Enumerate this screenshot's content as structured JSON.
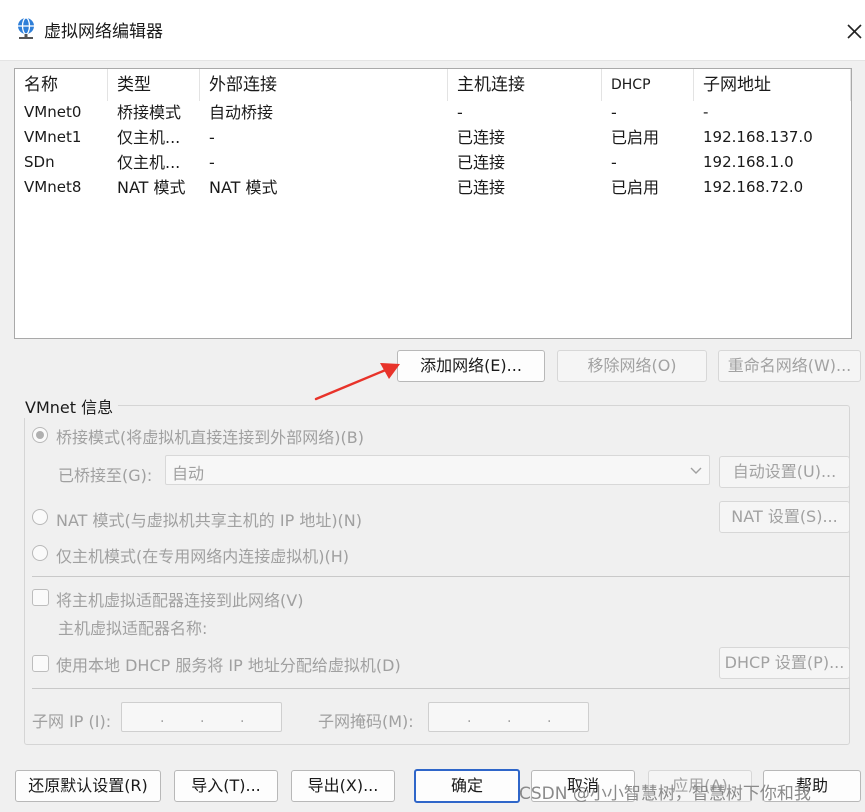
{
  "window": {
    "title": "虚拟网络编辑器"
  },
  "table": {
    "columns": [
      "名称",
      "类型",
      "外部连接",
      "主机连接",
      "DHCP",
      "子网地址"
    ],
    "rows": [
      [
        "VMnet0",
        "桥接模式",
        "自动桥接",
        "-",
        "-",
        "-"
      ],
      [
        "VMnet1",
        "仅主机...",
        "-",
        "已连接",
        "已启用",
        "192.168.137.0"
      ],
      [
        "SDn",
        "仅主机...",
        "-",
        "已连接",
        "-",
        "192.168.1.0"
      ],
      [
        "VMnet8",
        "NAT 模式",
        "NAT 模式",
        "已连接",
        "已启用",
        "192.168.72.0"
      ]
    ]
  },
  "list_buttons": {
    "add": "添加网络(E)...",
    "remove": "移除网络(O)",
    "rename": "重命名网络(W)..."
  },
  "vmnet_info": {
    "group_label": "VMnet 信息",
    "bridged_radio": "桥接模式(将虚拟机直接连接到外部网络)(B)",
    "bridged_to_label": "已桥接至(G):",
    "bridged_to_value": "自动",
    "auto_settings": "自动设置(U)...",
    "nat_radio": "NAT 模式(与虚拟机共享主机的 IP 地址)(N)",
    "nat_settings": "NAT 设置(S)...",
    "hostonly_radio": "仅主机模式(在专用网络内连接虚拟机)(H)",
    "connect_adapter": "将主机虚拟适配器连接到此网络(V)",
    "adapter_name_label": "主机虚拟适配器名称:",
    "use_dhcp": "使用本地 DHCP 服务将 IP 地址分配给虚拟机(D)",
    "dhcp_settings": "DHCP 设置(P)...",
    "subnet_ip_label": "子网 IP (I):",
    "subnet_mask_label": "子网掩码(M):",
    "ip_dot": "."
  },
  "footer": {
    "restore": "还原默认设置(R)",
    "import": "导入(T)...",
    "export": "导出(X)...",
    "ok": "确定",
    "cancel": "取消",
    "apply": "应用(A)",
    "help": "帮助"
  },
  "watermark": "CSDN @小小智慧树，智慧树下你和我",
  "colors": {
    "primary_border": "#2f66c9",
    "annotation_arrow": "#e8332a"
  }
}
